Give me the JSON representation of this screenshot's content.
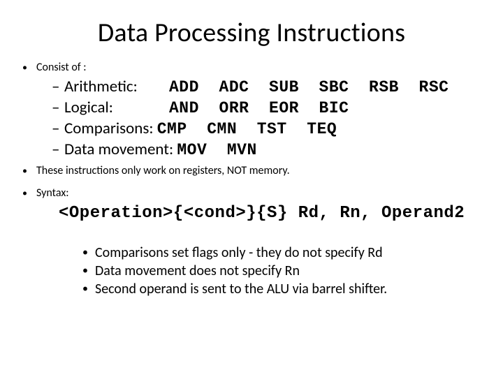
{
  "title": "Data Processing Instructions",
  "l1_consist": "Consist of :",
  "categories": [
    {
      "label": "Arithmetic:",
      "ops": "ADD  ADC  SUB  SBC  RSB  RSC"
    },
    {
      "label": "Logical:",
      "ops": "AND  ORR  EOR  BIC"
    },
    {
      "label": "Comparisons:",
      "ops": "CMP  CMN  TST  TEQ"
    },
    {
      "label": "Data movement:",
      "ops": "MOV  MVN"
    }
  ],
  "l1_registers": "These instructions only work on registers,  NOT  memory.",
  "l1_syntax": "Syntax:",
  "syntax_line": "<Operation>{<cond>}{S} Rd, Rn, Operand2",
  "notes": [
    "Comparisons set flags only - they do not specify Rd",
    "Data movement does not specify Rn",
    "Second operand is sent to the ALU via barrel shifter."
  ]
}
